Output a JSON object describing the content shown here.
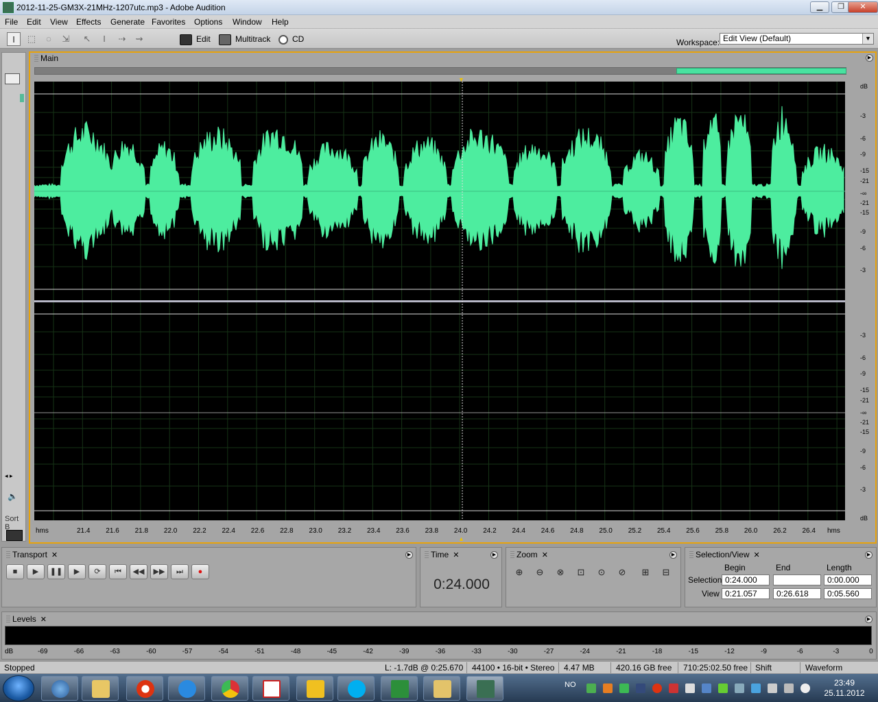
{
  "window": {
    "title": "2012-11-25-GM3X-21MHz-1207utc.mp3 - Adobe Audition",
    "min": "▁",
    "max": "❐",
    "close": "✕"
  },
  "menu": [
    "File",
    "Edit",
    "View",
    "Effects",
    "Generate",
    "Favorites",
    "Options",
    "Window",
    "Help"
  ],
  "toolbar": {
    "tools": [
      "I",
      "⬚",
      "◌",
      "⇲",
      "↖",
      "Ι",
      "⇢",
      "⇝"
    ],
    "edit_label": "Edit",
    "multitrack_label": "Multitrack",
    "cd_label": "CD",
    "workspace_label": "Workspace:",
    "workspace_value": "Edit View (Default)"
  },
  "main_panel": {
    "tab": "Main"
  },
  "left_panel": {
    "sort_label": "Sort B"
  },
  "db_labels_ch1": [
    "dB",
    "-3",
    "-6",
    "-9",
    "-15",
    "-21",
    "-∞",
    "-21",
    "-15",
    "-9",
    "-6",
    "-3"
  ],
  "db_labels_ch2": [
    "-3",
    "-6",
    "-9",
    "-15",
    "-21",
    "-∞",
    "-21",
    "-15",
    "-9",
    "-6",
    "-3",
    "dB"
  ],
  "timeline": {
    "start_label": "hms",
    "end_label": "hms",
    "ticks": [
      "21.4",
      "21.6",
      "21.8",
      "22.0",
      "22.2",
      "22.4",
      "22.6",
      "22.8",
      "23.0",
      "23.2",
      "23.4",
      "23.6",
      "23.8",
      "24.0",
      "24.2",
      "24.4",
      "24.6",
      "24.8",
      "25.0",
      "25.2",
      "25.4",
      "25.6",
      "25.8",
      "26.0",
      "26.2",
      "26.4"
    ]
  },
  "transport": {
    "title": "Transport",
    "buttons": [
      "■",
      "▶",
      "❚❚",
      "▶",
      "⟳",
      "⏮",
      "◀◀",
      "▶▶",
      "⏭",
      "●"
    ]
  },
  "time": {
    "title": "Time",
    "value": "0:24.000"
  },
  "zoom": {
    "title": "Zoom",
    "buttons": [
      "⊕",
      "⊖",
      "⊗",
      "⊡",
      "⊙",
      "⊘",
      "⊞",
      "⊟"
    ]
  },
  "selection_view": {
    "title": "Selection/View",
    "col_begin": "Begin",
    "col_end": "End",
    "col_length": "Length",
    "row_selection": "Selection",
    "row_view": "View",
    "sel_begin": "0:24.000",
    "sel_end": "",
    "sel_length": "0:00.000",
    "view_begin": "0:21.057",
    "view_end": "0:26.618",
    "view_length": "0:05.560"
  },
  "levels": {
    "title": "Levels",
    "scale": [
      "dB",
      "-69",
      "-66",
      "-63",
      "-60",
      "-57",
      "-54",
      "-51",
      "-48",
      "-45",
      "-42",
      "-39",
      "-36",
      "-33",
      "-30",
      "-27",
      "-24",
      "-21",
      "-18",
      "-15",
      "-12",
      "-9",
      "-6",
      "-3",
      "0"
    ]
  },
  "status": {
    "state": "Stopped",
    "level": "L: -1.7dB @  0:25.670",
    "format": "44100 • 16-bit • Stereo",
    "size": "4.47 MB",
    "free": "420.16 GB free",
    "time_free": "710:25:02.50 free",
    "key": "Shift",
    "view": "Waveform"
  },
  "taskbar": {
    "lang": "NO",
    "time": "23:49",
    "date": "25.11.2012"
  },
  "colors": {
    "waveform": "#4ded9f",
    "accent": "#e8a30c"
  }
}
